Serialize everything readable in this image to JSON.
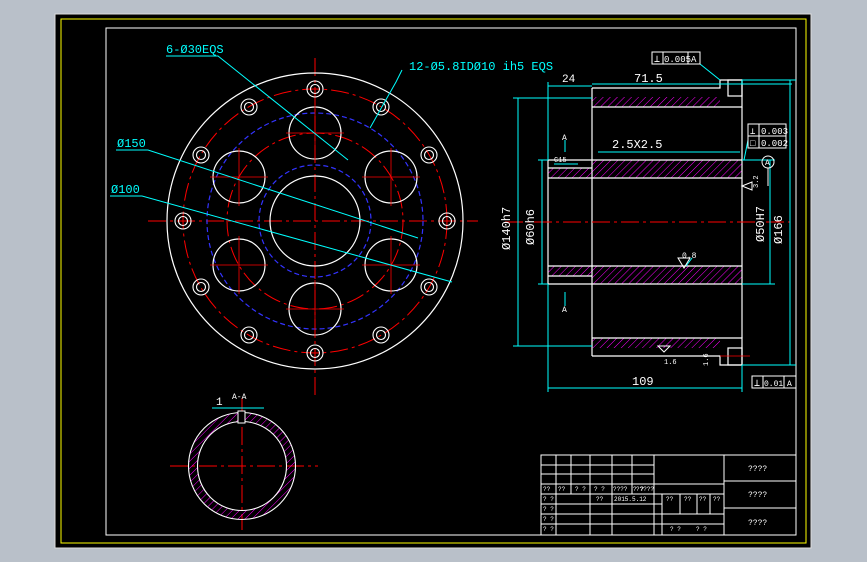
{
  "colors": {
    "background": "#b9c0c9",
    "sheet": "#000000",
    "frame": "#ffff00",
    "outline": "#ffffff",
    "dimension": "#00ffff",
    "centerline": "#ff0000",
    "hidden": "#3333ff",
    "hatch": "#ff00ff",
    "text_white": "#ffffff"
  },
  "front_view": {
    "callout_holes": "6-Ø30EQS",
    "callout_bolts": "12-Ø5.8IDØ10 ih5 EQS",
    "dia_150": "Ø150",
    "dia_100": "Ø100"
  },
  "section_view": {
    "dim_24": "24",
    "dim_71_5": "71.5",
    "flatness_tol": "0.005",
    "flatness_datum": "A",
    "perp_tol": "0.003",
    "para_tol": "0.002",
    "datum_A": "A",
    "cut_a": "A",
    "chamfer": "2.5X2.5",
    "small_c": "C15",
    "dia_140h7": "Ø140h7",
    "dia_60h6": "Ø60h6",
    "dia_50H7": "Ø50H7",
    "dia_166": "Ø166",
    "rough_08": "0.8",
    "rough_32": "3.2",
    "rough_16a": "1.6",
    "rough_16b": "1.6",
    "dim_109": "109",
    "runout_tol": "0.01",
    "runout_datum": "A"
  },
  "detail_view": {
    "label": "A-A",
    "dim_1": "1"
  },
  "title_block": {
    "cell_r3c1": "?? ",
    "cell_r3c2": "??",
    "cell_r3c3": "? ?",
    "cell_r3c4": "? ?",
    "cell_r3c5": "????",
    "cell_r3c6": "? ?",
    "cell_r3c7": "?????",
    "cell_r4c1": "? ?",
    "cell_r4c4": "??",
    "cell_r4c5": "2015.5.12",
    "cell_r4c7": "??",
    "cell_r4c8": "??",
    "cell_r4c9": "??",
    "cell_r4c10": "??",
    "cell_r5c1": "? ?",
    "cell_r6c1": "? ?",
    "cell_r7c1": "? ?",
    "cell_r7c5": "? ?",
    "cell_r7c6": "? ?",
    "right_top": "????",
    "right_mid": "????",
    "right_bot": "????"
  }
}
